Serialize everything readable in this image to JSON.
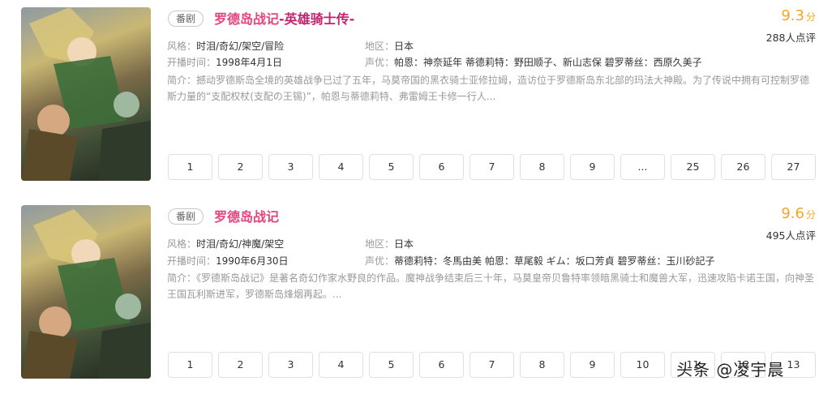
{
  "results": [
    {
      "tag": "番剧",
      "title": "罗德岛战记",
      "subtitle": "-英雄骑士传-",
      "score": "9.3",
      "score_unit": "分",
      "rating_count": "288人点评",
      "style_label": "风格：",
      "style_value": "时泪/奇幻/架空/冒险",
      "region_label": "地区：",
      "region_value": "日本",
      "air_label": "开播时间：",
      "air_value": "1998年4月1日",
      "cast_label": "声优：",
      "cast_value": "帕恩：神奈延年 蒂德莉特：野田顺子、新山志保 碧罗蒂丝：西原久美子",
      "desc_label": "简介：",
      "desc_value": "撼动罗德斯岛全境的英雄战争已过了五年，马莫帝国的黑衣骑士亚修拉姆，造访位于罗德斯岛东北部的玛法大神殿。为了传说中拥有可控制罗德斯力量的“支配权杖(支配の王锡)”，帕恩与蒂德莉特、弗雷姆王卡修一行人...",
      "pages": [
        "1",
        "2",
        "3",
        "4",
        "5",
        "6",
        "7",
        "8",
        "9",
        "...",
        "25",
        "26",
        "27"
      ]
    },
    {
      "tag": "番剧",
      "title": "罗德岛战记",
      "subtitle": "",
      "score": "9.6",
      "score_unit": "分",
      "rating_count": "495人点评",
      "style_label": "风格：",
      "style_value": "时泪/奇幻/神魔/架空",
      "region_label": "地区：",
      "region_value": "日本",
      "air_label": "开播时间：",
      "air_value": "1990年6月30日",
      "cast_label": "声优：",
      "cast_value": "蒂德莉特：冬馬由美 帕恩：草尾毅 ギム：坂口芳貞 碧罗蒂丝：玉川砂記子",
      "desc_label": "简介：",
      "desc_value": "《罗德斯岛战记》是著名奇幻作家水野良的作品。魔神战争结束后三十年，马莫皇帝贝鲁特率领暗黑骑士和魔兽大军，迅速攻陷卡诺王国，向神圣王国瓦利斯进军，罗德斯岛烽烟再起。...",
      "pages": [
        "1",
        "2",
        "3",
        "4",
        "5",
        "6",
        "7",
        "8",
        "9",
        "10",
        "11",
        "12",
        "13"
      ]
    }
  ],
  "watermark": {
    "prefix": "头条",
    "handle": "@凌宇晨"
  },
  "colors": {
    "title": "#e8437d",
    "score": "#f5a623",
    "label": "#999999"
  }
}
